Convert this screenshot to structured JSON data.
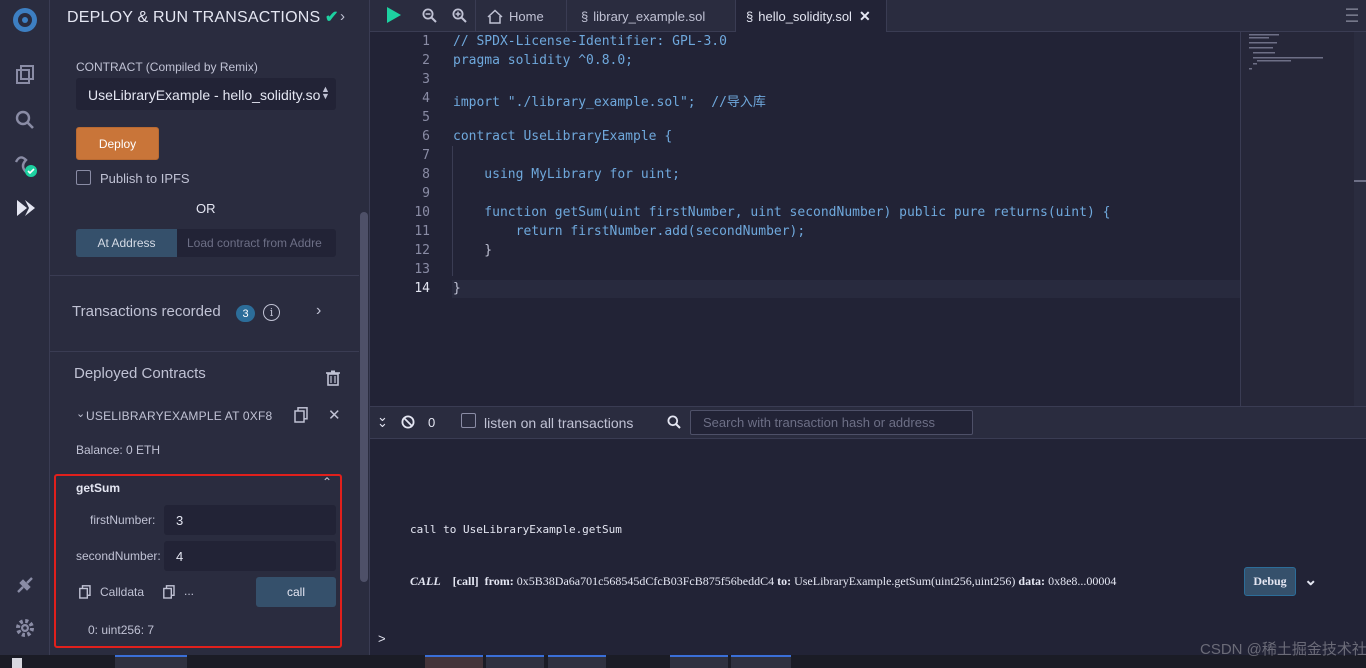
{
  "sidebar": {
    "title": "DEPLOY & RUN TRANSACTIONS",
    "contract_label": "CONTRACT",
    "contract_note": "(Compiled by Remix)",
    "contract_value": "UseLibraryExample - hello_solidity.so",
    "deploy_label": "Deploy",
    "publish_label": "Publish to IPFS",
    "or_label": "OR",
    "at_address_label": "At Address",
    "at_address_placeholder": "Load contract from Addre",
    "tx_recorded_label": "Transactions recorded",
    "tx_recorded_count": "3",
    "deployed_label": "Deployed Contracts",
    "instance_title": "USELIBRARYEXAMPLE AT 0XF8",
    "balance": "Balance: 0 ETH",
    "function_name": "getSum",
    "param1_label": "firstNumber:",
    "param1_value": "3",
    "param2_label": "secondNumber:",
    "param2_value": "4",
    "calldata_label": "Calldata",
    "ellipsis": "...",
    "call_label": "call",
    "result": "0: uint256: 7"
  },
  "tabs": [
    {
      "label": "Home"
    },
    {
      "label": "library_example.sol"
    },
    {
      "label": "hello_solidity.sol"
    }
  ],
  "code": [
    {
      "n": "1",
      "text": "// SPDX-License-Identifier: GPL-3.0"
    },
    {
      "n": "2",
      "text": "pragma solidity ^0.8.0;"
    },
    {
      "n": "3",
      "text": ""
    },
    {
      "n": "4",
      "text": "import \"./library_example.sol\";  //导入库"
    },
    {
      "n": "5",
      "text": ""
    },
    {
      "n": "6",
      "text": "contract UseLibraryExample {"
    },
    {
      "n": "7",
      "text": ""
    },
    {
      "n": "8",
      "text": "    using MyLibrary for uint;"
    },
    {
      "n": "9",
      "text": ""
    },
    {
      "n": "10",
      "text": "    function getSum(uint firstNumber, uint secondNumber) public pure returns(uint) {"
    },
    {
      "n": "11",
      "text": "        return firstNumber.add(secondNumber);"
    },
    {
      "n": "12",
      "text": "    }"
    },
    {
      "n": "13",
      "text": ""
    },
    {
      "n": "14",
      "text": "}"
    }
  ],
  "terminal": {
    "count": "0",
    "listen_label": "listen on all transactions",
    "search_placeholder": "Search with transaction hash or address",
    "call_line": "call to UseLibraryExample.getSum",
    "log_call": "CALL",
    "log_tag": "[call]",
    "log_from_label": "from:",
    "log_from": "0x5B38Da6a701c568545dCfcB03FcB875f56beddC4",
    "log_to_label": "to:",
    "log_to": "UseLibraryExample.getSum(uint256,uint256)",
    "log_data_label": "data:",
    "log_data": "0x8e8...00004",
    "debug_label": "Debug",
    "prompt": ">"
  },
  "watermark": "CSDN @稀土掘金技术社区",
  "colors": {
    "accent_orange": "#c97539",
    "highlight_red": "#e0201c",
    "check_green": "#1dd1a1",
    "keyword_blue": "#6fa8dc"
  }
}
